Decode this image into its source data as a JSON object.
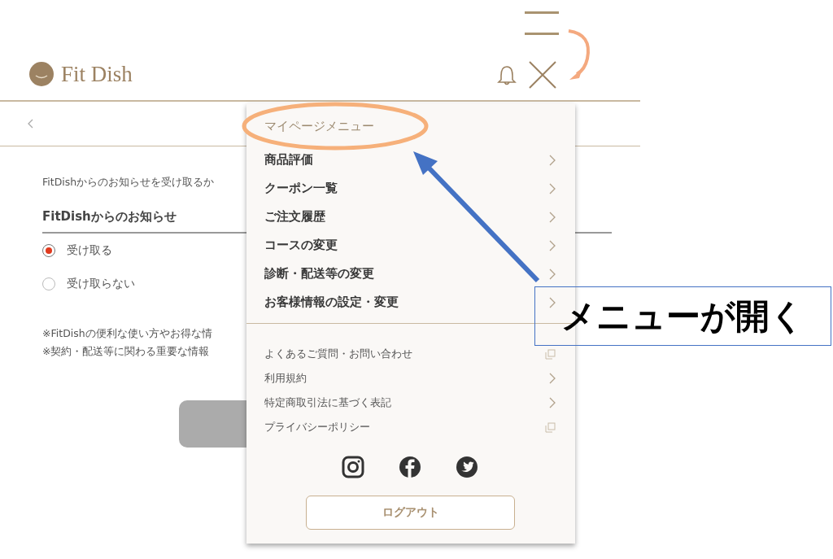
{
  "header": {
    "logo": "Fit Dish"
  },
  "content": {
    "intro": "FitDishからのお知らせを受け取るか",
    "heading": "FitDishからのお知らせ",
    "options": [
      {
        "label": "受け取る",
        "selected": true
      },
      {
        "label": "受け取らない",
        "selected": false
      }
    ],
    "notes": [
      "※FitDishの便利な使い方やお得な情",
      "※契約・配送等に関わる重要な情報"
    ]
  },
  "menu": {
    "title": "マイページメニュー",
    "main_items": [
      {
        "label": "商品評価",
        "kind": "chevron"
      },
      {
        "label": "クーポン一覧",
        "kind": "chevron"
      },
      {
        "label": "ご注文履歴",
        "kind": "chevron"
      },
      {
        "label": "コースの変更",
        "kind": "chevron"
      },
      {
        "label": "診断・配送等の変更",
        "kind": "chevron"
      },
      {
        "label": "お客様情報の設定・変更",
        "kind": "chevron"
      }
    ],
    "sub_items": [
      {
        "label": "よくあるご質問・お問い合わせ",
        "kind": "external"
      },
      {
        "label": "利用規約",
        "kind": "chevron"
      },
      {
        "label": "特定商取引法に基づく表記",
        "kind": "chevron"
      },
      {
        "label": "プライバシーポリシー",
        "kind": "external"
      }
    ],
    "logout": "ログアウト"
  },
  "callout": {
    "text": "メニューが開く"
  }
}
